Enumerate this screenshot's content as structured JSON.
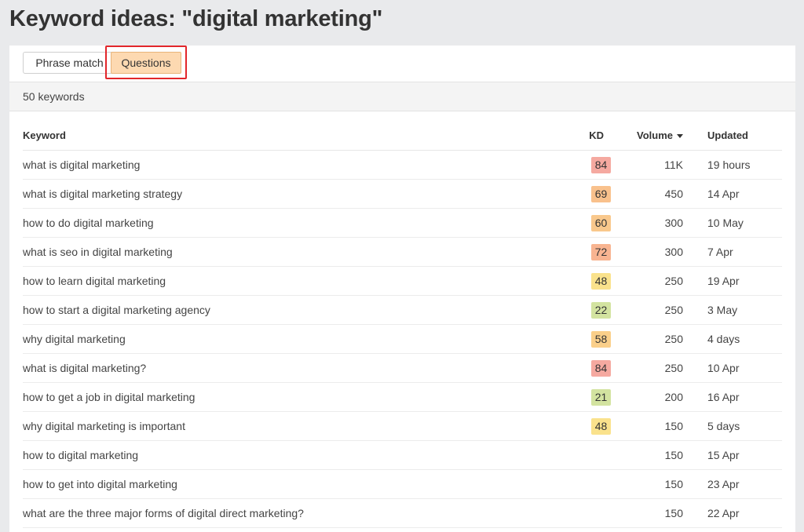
{
  "page": {
    "title": "Keyword ideas: \"digital marketing\""
  },
  "tabs": [
    {
      "label": "Phrase match",
      "active": false
    },
    {
      "label": "Questions",
      "active": true
    }
  ],
  "summary": {
    "count_label": "50 keywords"
  },
  "table": {
    "headers": {
      "keyword": "Keyword",
      "kd": "KD",
      "volume": "Volume",
      "updated": "Updated"
    },
    "sort": {
      "column": "volume",
      "direction": "desc"
    },
    "rows": [
      {
        "keyword": "what is digital marketing",
        "kd": "84",
        "kd_color": "#f5a9a0",
        "volume": "11K",
        "updated": "19 hours"
      },
      {
        "keyword": "what is digital marketing strategy",
        "kd": "69",
        "kd_color": "#f9c18c",
        "volume": "450",
        "updated": "14 Apr"
      },
      {
        "keyword": "how to do digital marketing",
        "kd": "60",
        "kd_color": "#f9c88c",
        "volume": "300",
        "updated": "10 May"
      },
      {
        "keyword": "what is seo in digital marketing",
        "kd": "72",
        "kd_color": "#f8b491",
        "volume": "300",
        "updated": "7 Apr"
      },
      {
        "keyword": "how to learn digital marketing",
        "kd": "48",
        "kd_color": "#fae28c",
        "volume": "250",
        "updated": "19 Apr"
      },
      {
        "keyword": "how to start a digital marketing agency",
        "kd": "22",
        "kd_color": "#d3e3a0",
        "volume": "250",
        "updated": "3 May"
      },
      {
        "keyword": "why digital marketing",
        "kd": "58",
        "kd_color": "#facf8a",
        "volume": "250",
        "updated": "4 days"
      },
      {
        "keyword": "what is digital marketing?",
        "kd": "84",
        "kd_color": "#f5a9a0",
        "volume": "250",
        "updated": "10 Apr"
      },
      {
        "keyword": "how to get a job in digital marketing",
        "kd": "21",
        "kd_color": "#d3e3a0",
        "volume": "200",
        "updated": "16 Apr"
      },
      {
        "keyword": "why digital marketing is important",
        "kd": "48",
        "kd_color": "#fae28c",
        "volume": "150",
        "updated": "5 days"
      },
      {
        "keyword": "how to digital marketing",
        "kd": "",
        "kd_color": "",
        "volume": "150",
        "updated": "15 Apr"
      },
      {
        "keyword": "how to get into digital marketing",
        "kd": "",
        "kd_color": "",
        "volume": "150",
        "updated": "23 Apr"
      },
      {
        "keyword": "what are the three major forms of digital direct marketing?",
        "kd": "",
        "kd_color": "",
        "volume": "150",
        "updated": "22 Apr"
      }
    ]
  },
  "colors": {
    "highlight": "#e2262b",
    "active_tab_bg": "#fdd9b1",
    "active_tab_border": "#e8b47a"
  }
}
